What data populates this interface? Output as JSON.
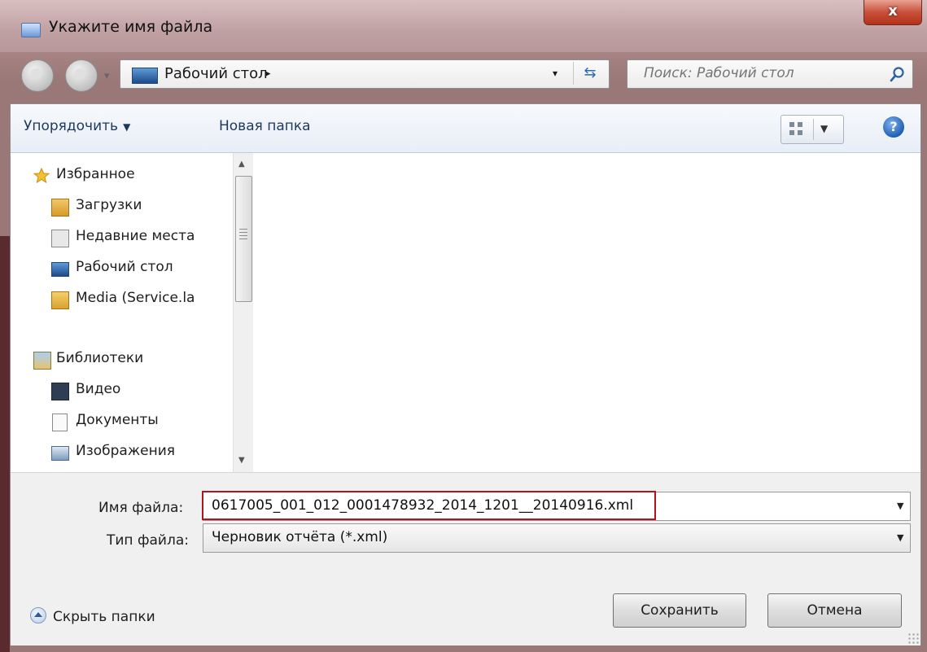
{
  "window": {
    "title": "Укажите имя файла",
    "close_glyph": "x"
  },
  "address": {
    "location": "Рабочий стол",
    "path_arrow": "▸",
    "dropdown_glyph": "▾",
    "refresh_glyph": "⇆",
    "history_glyph": "▾"
  },
  "search": {
    "placeholder": "Поиск: Рабочий стол"
  },
  "toolbar": {
    "organize_label": "Упорядочить",
    "organize_caret": "▼",
    "new_folder_label": "Новая папка",
    "view_dropdown": "▼",
    "help_glyph": "?"
  },
  "navpane": {
    "favorites_label": "Избранное",
    "favorites": [
      {
        "label": "Загрузки",
        "icon": "downloads-folder-icon"
      },
      {
        "label": "Недавние места",
        "icon": "recent-places-icon"
      },
      {
        "label": "Рабочий стол",
        "icon": "desktop-icon"
      },
      {
        "label": "Media (Service.la",
        "icon": "network-folder-icon"
      }
    ],
    "libraries_label": "Библиотеки",
    "libraries": [
      {
        "label": "Видео",
        "icon": "video-library-icon"
      },
      {
        "label": "Документы",
        "icon": "documents-library-icon"
      },
      {
        "label": "Изображения",
        "icon": "pictures-library-icon"
      }
    ],
    "scroll_up": "▲",
    "scroll_down": "▼"
  },
  "form": {
    "filename_label": "Имя файла:",
    "filename_value": "0617005_001_012_0001478932_2014_1201__20140916.xml",
    "filetype_label": "Тип файла:",
    "filetype_value": "Черновик отчёта (*.xml)",
    "dropdown_glyph": "▼"
  },
  "footer": {
    "hide_folders_label": "Скрыть папки",
    "save_label": "Сохранить",
    "cancel_label": "Отмена"
  },
  "colors": {
    "highlight": "#b0141e",
    "close": "#c9503a",
    "link": "#1e395b"
  }
}
